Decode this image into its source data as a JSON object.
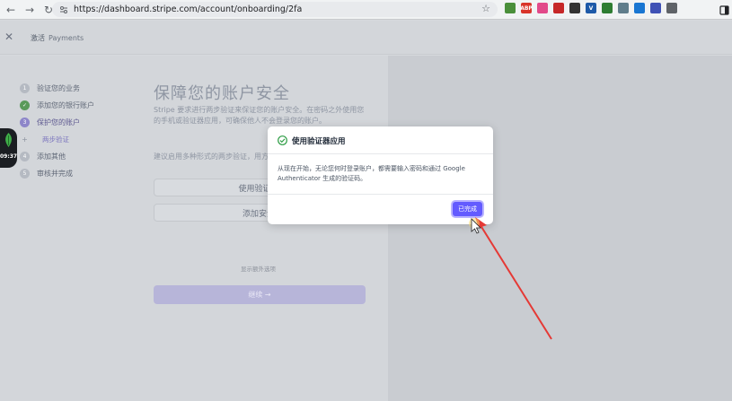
{
  "browser": {
    "url": "https://dashboard.stripe.com/account/onboarding/2fa",
    "extensions": [
      {
        "name": "image-ext",
        "color": "#4a8f3a"
      },
      {
        "name": "abp-ext",
        "label": "ABP",
        "color": "#d9352b"
      },
      {
        "name": "pink-ext",
        "color": "#e24a8a"
      },
      {
        "name": "red-ext",
        "color": "#c62828"
      },
      {
        "name": "pie-ext",
        "color": "#333333"
      },
      {
        "name": "v-ext",
        "label": "V",
        "color": "#1e5aa8"
      },
      {
        "name": "tree-ext",
        "color": "#2e7d32"
      },
      {
        "name": "robot-ext",
        "color": "#607d8b"
      },
      {
        "name": "blue-ext",
        "color": "#1976d2"
      },
      {
        "name": "counter-ext",
        "color": "#3f51b5"
      },
      {
        "name": "puzzle-ext",
        "color": "#5f6368"
      }
    ]
  },
  "topbar": {
    "title": "激活",
    "subtitle": "Payments"
  },
  "steps": [
    {
      "num": "1",
      "label": "验证您的业务",
      "state": "pending"
    },
    {
      "num": "✓",
      "label": "添加您的银行账户",
      "state": "done"
    },
    {
      "num": "3",
      "label": "保护您的账户",
      "state": "current"
    },
    {
      "num": "4",
      "label": "添加其他",
      "state": "pending"
    },
    {
      "num": "5",
      "label": "审核并完成",
      "state": "pending"
    }
  ],
  "substep": {
    "label": "两步验证"
  },
  "main": {
    "title": "保障您的账户安全",
    "desc": "Stripe 要求进行两步验证来保证您的账户安全。在密码之外使用您的手机或验证器应用，可确保他人不会登录您的账户。",
    "desc2": "建议启用多种形式的两步验证，用方式。",
    "option1": "使用验证器",
    "option2": "添加安全",
    "more_link": "显示额外选项",
    "continue": "继续 →"
  },
  "timer": {
    "time": "09:37"
  },
  "modal": {
    "title": "使用验证器应用",
    "body": "从现在开始，无论您何时登录账户，都需要输入密码和通过 Google Authenticator 生成的验证码。",
    "done": "已完成"
  },
  "colors": {
    "accent": "#635bff",
    "success": "#2e9d45",
    "annotation": "#e53935"
  }
}
